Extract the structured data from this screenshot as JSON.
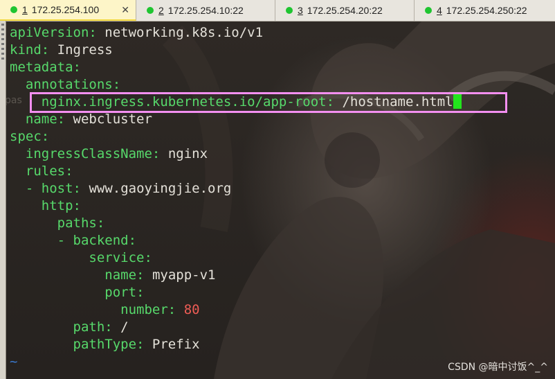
{
  "tabs": [
    {
      "num": "1",
      "label": "172.25.254.100",
      "active": true,
      "close": "✕"
    },
    {
      "num": "2",
      "label": "172.25.254.10:22",
      "active": false
    },
    {
      "num": "3",
      "label": "172.25.254.20:22",
      "active": false
    },
    {
      "num": "4",
      "label": "172.25.254.250:22",
      "active": false
    }
  ],
  "code": {
    "l1_key": "apiVersion",
    "l1_colon": ":",
    "l1_val": " networking.k8s.io/v1",
    "l2_key": "kind",
    "l2_colon": ":",
    "l2_val": " Ingress",
    "l3_key": "metadata",
    "l3_colon": ":",
    "l4_key": "annotations",
    "l4_colon": ":",
    "l5_key": "nginx.ingress.kubernetes.io/app-root",
    "l5_colon": ":",
    "l5_val": " /hostname.html",
    "l6_key": "name",
    "l6_colon": ":",
    "l6_val": " webcluster",
    "l7_key": "spec",
    "l7_colon": ":",
    "l8_key": "ingressClassName",
    "l8_colon": ":",
    "l8_val": " nginx",
    "l9_key": "rules",
    "l9_colon": ":",
    "l10_dash": "- ",
    "l10_key": "host",
    "l10_colon": ":",
    "l10_val": " www.gaoyingjie.org",
    "l11_key": "http",
    "l11_colon": ":",
    "l12_key": "paths",
    "l12_colon": ":",
    "l13_dash": "- ",
    "l13_key": "backend",
    "l13_colon": ":",
    "l14_key": "service",
    "l14_colon": ":",
    "l15_key": "name",
    "l15_colon": ":",
    "l15_val": " myapp-v1",
    "l16_key": "port",
    "l16_colon": ":",
    "l17_key": "number",
    "l17_colon": ":",
    "l17_num": " 80",
    "l18_key": "path",
    "l18_colon": ":",
    "l18_val": " /",
    "l19_key": "pathType",
    "l19_colon": ":",
    "l19_val": " Prefix",
    "tilde": "~"
  },
  "ghost_text": "pas",
  "watermark": "CSDN @暗中讨饭^_^",
  "colors": {
    "key": "#57d96b",
    "number": "#ee5c55",
    "cursor": "#22e51c",
    "highlight_box": "#f38ff0",
    "tab_dot": "#1fc531"
  }
}
